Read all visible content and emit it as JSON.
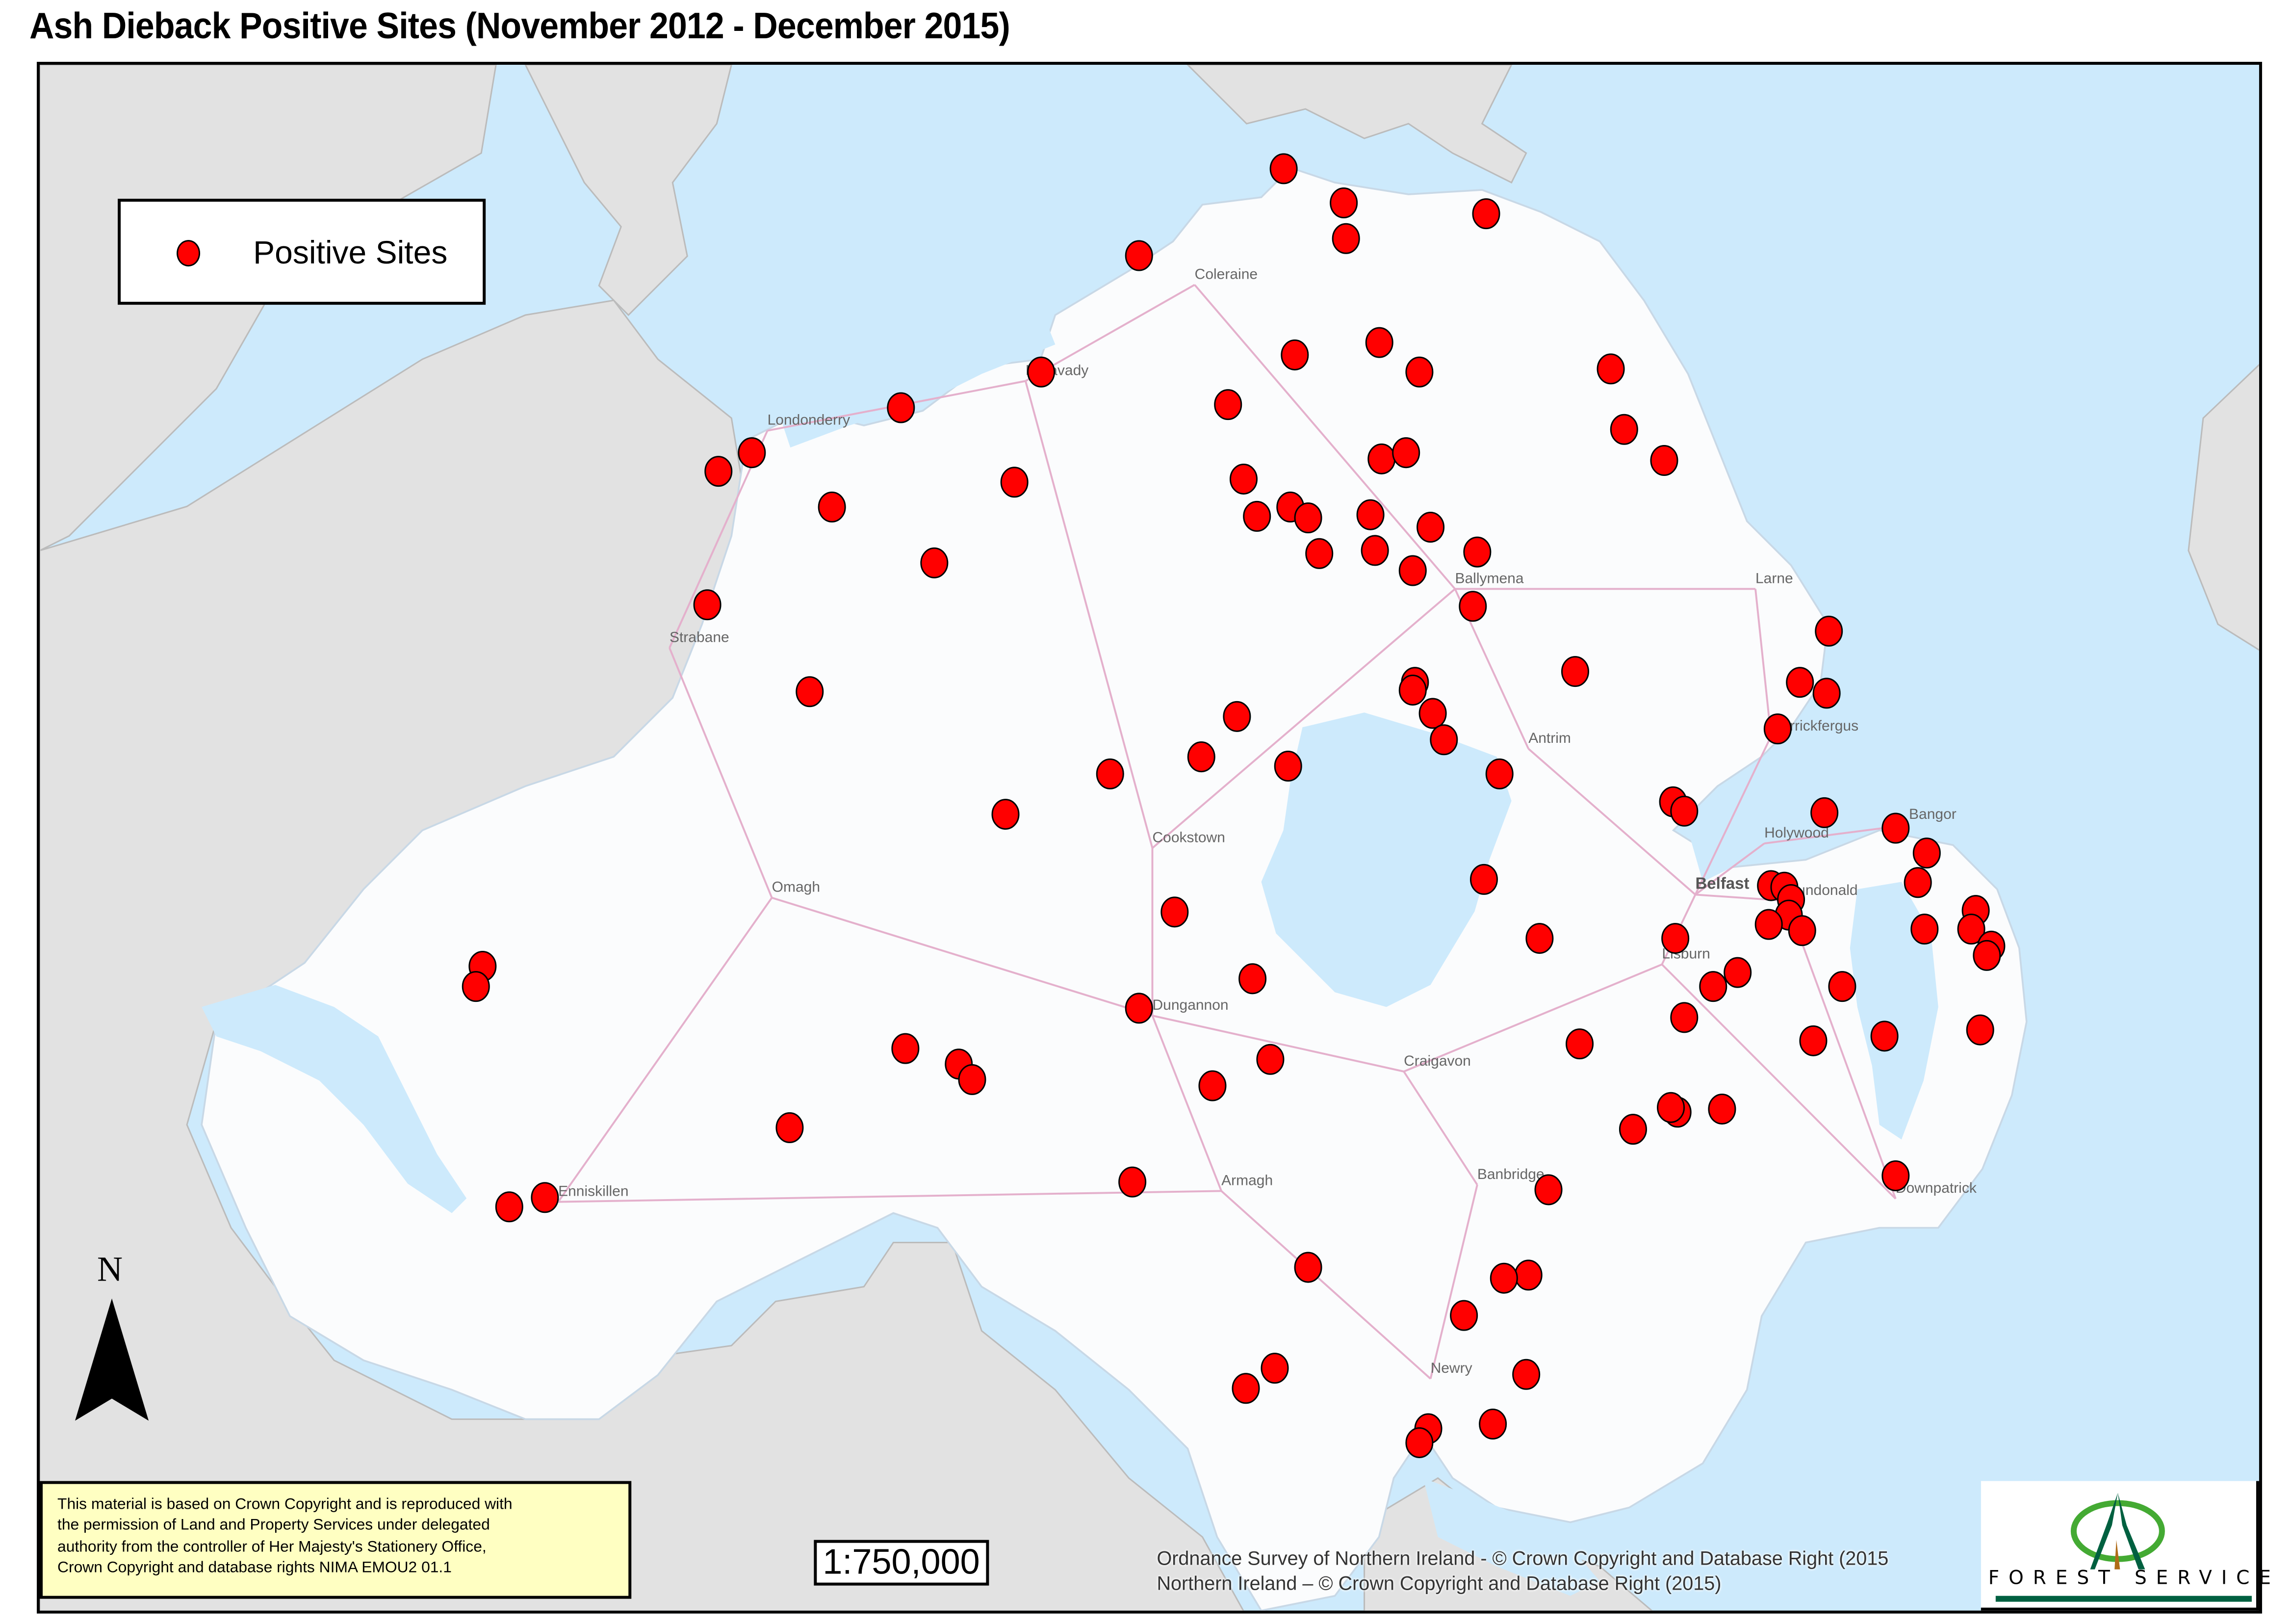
{
  "title": "Ash Dieback Positive Sites (November 2012 - December 2015)",
  "legend": {
    "symbol": "red-circle",
    "symbol_color": "#ff0000",
    "label": "Positive Sites"
  },
  "north_arrow": {
    "label": "N"
  },
  "scale": "1:750,000",
  "copyright_box": {
    "lines": [
      "This material is based on Crown Copyright and is reproduced with",
      "the permission of Land and Property Services under delegated",
      "authority from the controller of Her Majesty's Stationery Office,",
      "Crown Copyright and database rights NIMA EMOU2 01.1"
    ],
    "background": "#ffffc2"
  },
  "attribution": {
    "line1": "Ordnance Survey of Northern Ireland - © Crown Copyright and Database Right (2015",
    "line2": "Northern Ireland – © Crown Copyright and Database Right (2015)"
  },
  "logo": {
    "text": "FOREST SERVICE",
    "primary_color": "#006040",
    "ring_color": "#44aa33",
    "trunk_color": "#b06c18"
  },
  "colors": {
    "sea": "#cdeafc",
    "land_ni": "#ffffff",
    "land_roi": "#e2e2e2",
    "roads": "#e0a8c8",
    "rivers": "#a8d4f0",
    "woodland": "#c8f0b0"
  },
  "towns": [
    {
      "name": "Coleraine",
      "pos": [
        0.519,
        0.138
      ],
      "bold": false
    },
    {
      "name": "Limavady",
      "pos": [
        0.443,
        0.2
      ],
      "bold": false
    },
    {
      "name": "Londonderry",
      "pos": [
        0.327,
        0.232
      ],
      "bold": false
    },
    {
      "name": "Strabane",
      "pos": [
        0.283,
        0.372
      ],
      "bold": false
    },
    {
      "name": "Ballymena",
      "pos": [
        0.636,
        0.334
      ],
      "bold": false
    },
    {
      "name": "Larne",
      "pos": [
        0.771,
        0.334
      ],
      "bold": false
    },
    {
      "name": "Antrim",
      "pos": [
        0.669,
        0.437
      ],
      "bold": false
    },
    {
      "name": "Carrickfergus",
      "pos": [
        0.778,
        0.429
      ],
      "bold": false
    },
    {
      "name": "Cookstown",
      "pos": [
        0.5,
        0.501
      ],
      "bold": false
    },
    {
      "name": "Omagh",
      "pos": [
        0.329,
        0.533
      ],
      "bold": false
    },
    {
      "name": "Holywood",
      "pos": [
        0.775,
        0.498
      ],
      "bold": false
    },
    {
      "name": "Bangor",
      "pos": [
        0.84,
        0.486
      ],
      "bold": false
    },
    {
      "name": "Belfast",
      "pos": [
        0.744,
        0.531
      ],
      "bold": true
    },
    {
      "name": "Dundonald",
      "pos": [
        0.785,
        0.535
      ],
      "bold": false
    },
    {
      "name": "Lisburn",
      "pos": [
        0.729,
        0.576
      ],
      "bold": false
    },
    {
      "name": "Dungannon",
      "pos": [
        0.5,
        0.609
      ],
      "bold": false
    },
    {
      "name": "Craigavon",
      "pos": [
        0.613,
        0.645
      ],
      "bold": false
    },
    {
      "name": "Enniskillen",
      "pos": [
        0.233,
        0.729
      ],
      "bold": false
    },
    {
      "name": "Armagh",
      "pos": [
        0.531,
        0.722
      ],
      "bold": false
    },
    {
      "name": "Banbridge",
      "pos": [
        0.646,
        0.718
      ],
      "bold": false
    },
    {
      "name": "Downpatrick",
      "pos": [
        0.834,
        0.727
      ],
      "bold": false
    },
    {
      "name": "Newry",
      "pos": [
        0.625,
        0.843
      ],
      "bold": false
    }
  ],
  "sites": [
    [
      0.559,
      0.067
    ],
    [
      0.586,
      0.089
    ],
    [
      0.587,
      0.112
    ],
    [
      0.65,
      0.096
    ],
    [
      0.494,
      0.123
    ],
    [
      0.45,
      0.198
    ],
    [
      0.387,
      0.221
    ],
    [
      0.32,
      0.25
    ],
    [
      0.305,
      0.262
    ],
    [
      0.356,
      0.285
    ],
    [
      0.438,
      0.269
    ],
    [
      0.402,
      0.321
    ],
    [
      0.3,
      0.348
    ],
    [
      0.346,
      0.404
    ],
    [
      0.564,
      0.187
    ],
    [
      0.602,
      0.179
    ],
    [
      0.62,
      0.198
    ],
    [
      0.534,
      0.219
    ],
    [
      0.706,
      0.196
    ],
    [
      0.712,
      0.235
    ],
    [
      0.73,
      0.255
    ],
    [
      0.541,
      0.267
    ],
    [
      0.547,
      0.291
    ],
    [
      0.562,
      0.285
    ],
    [
      0.57,
      0.292
    ],
    [
      0.575,
      0.315
    ],
    [
      0.598,
      0.29
    ],
    [
      0.6,
      0.313
    ],
    [
      0.603,
      0.254
    ],
    [
      0.614,
      0.25
    ],
    [
      0.625,
      0.298
    ],
    [
      0.617,
      0.326
    ],
    [
      0.646,
      0.314
    ],
    [
      0.644,
      0.349
    ],
    [
      0.618,
      0.398
    ],
    [
      0.617,
      0.403
    ],
    [
      0.626,
      0.418
    ],
    [
      0.631,
      0.435
    ],
    [
      0.69,
      0.391
    ],
    [
      0.538,
      0.42
    ],
    [
      0.522,
      0.446
    ],
    [
      0.561,
      0.452
    ],
    [
      0.481,
      0.457
    ],
    [
      0.434,
      0.483
    ],
    [
      0.656,
      0.457
    ],
    [
      0.649,
      0.525
    ],
    [
      0.674,
      0.563
    ],
    [
      0.804,
      0.365
    ],
    [
      0.791,
      0.398
    ],
    [
      0.803,
      0.405
    ],
    [
      0.781,
      0.428
    ],
    [
      0.734,
      0.475
    ],
    [
      0.739,
      0.481
    ],
    [
      0.802,
      0.482
    ],
    [
      0.834,
      0.492
    ],
    [
      0.848,
      0.508
    ],
    [
      0.844,
      0.527
    ],
    [
      0.847,
      0.557
    ],
    [
      0.87,
      0.545
    ],
    [
      0.868,
      0.557
    ],
    [
      0.877,
      0.568
    ],
    [
      0.875,
      0.574
    ],
    [
      0.872,
      0.622
    ],
    [
      0.778,
      0.529
    ],
    [
      0.784,
      0.53
    ],
    [
      0.787,
      0.538
    ],
    [
      0.786,
      0.548
    ],
    [
      0.777,
      0.554
    ],
    [
      0.792,
      0.558
    ],
    [
      0.735,
      0.563
    ],
    [
      0.752,
      0.594
    ],
    [
      0.763,
      0.585
    ],
    [
      0.739,
      0.614
    ],
    [
      0.81,
      0.594
    ],
    [
      0.797,
      0.629
    ],
    [
      0.829,
      0.626
    ],
    [
      0.692,
      0.631
    ],
    [
      0.736,
      0.675
    ],
    [
      0.733,
      0.672
    ],
    [
      0.716,
      0.686
    ],
    [
      0.756,
      0.673
    ],
    [
      0.834,
      0.716
    ],
    [
      0.51,
      0.546
    ],
    [
      0.545,
      0.589
    ],
    [
      0.494,
      0.608
    ],
    [
      0.553,
      0.641
    ],
    [
      0.527,
      0.658
    ],
    [
      0.389,
      0.634
    ],
    [
      0.413,
      0.644
    ],
    [
      0.419,
      0.654
    ],
    [
      0.337,
      0.685
    ],
    [
      0.491,
      0.72
    ],
    [
      0.199,
      0.581
    ],
    [
      0.196,
      0.594
    ],
    [
      0.211,
      0.736
    ],
    [
      0.227,
      0.73
    ],
    [
      0.57,
      0.775
    ],
    [
      0.678,
      0.725
    ],
    [
      0.669,
      0.78
    ],
    [
      0.658,
      0.782
    ],
    [
      0.64,
      0.806
    ],
    [
      0.668,
      0.844
    ],
    [
      0.555,
      0.84
    ],
    [
      0.542,
      0.853
    ],
    [
      0.624,
      0.879
    ],
    [
      0.62,
      0.888
    ],
    [
      0.653,
      0.876
    ]
  ]
}
